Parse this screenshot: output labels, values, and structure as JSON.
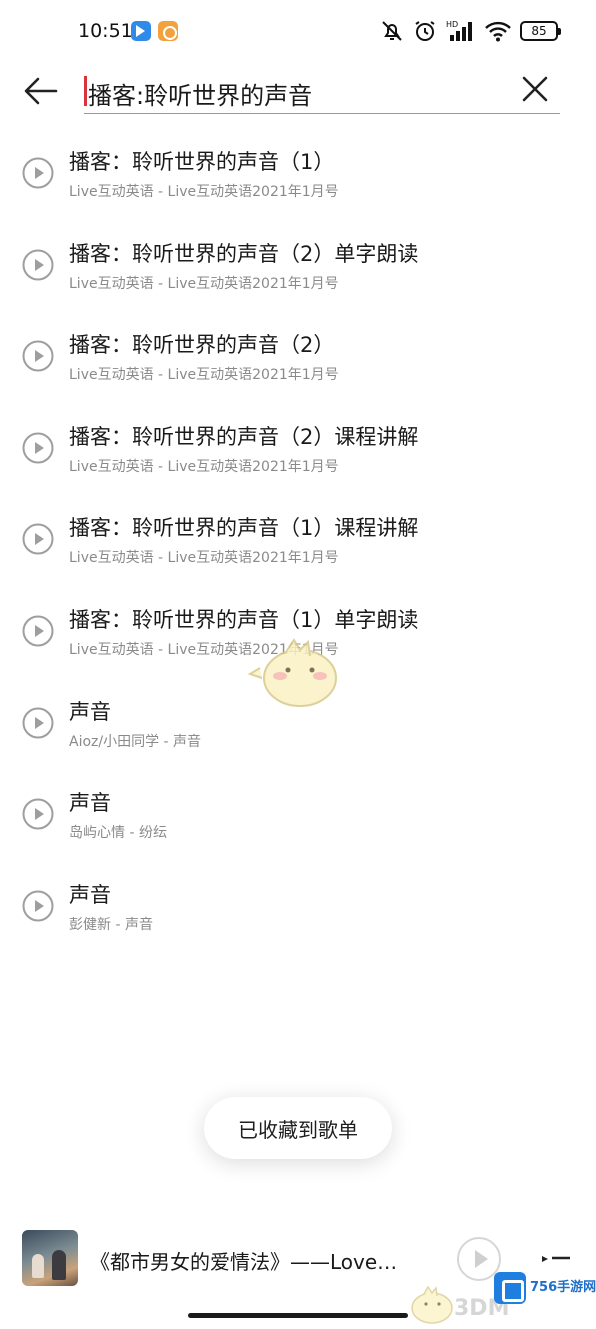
{
  "status_bar": {
    "time": "10:51",
    "battery": "85",
    "network_label": "HD"
  },
  "search": {
    "query": "播客:聆听世界的声音"
  },
  "results": [
    {
      "title": "播客：聆听世界的声音（1）",
      "subtitle": "Live互动英语 - Live互动英语2021年1月号"
    },
    {
      "title": "播客：聆听世界的声音（2）单字朗读",
      "subtitle": "Live互动英语 - Live互动英语2021年1月号"
    },
    {
      "title": "播客：聆听世界的声音（2）",
      "subtitle": "Live互动英语 - Live互动英语2021年1月号"
    },
    {
      "title": "播客：聆听世界的声音（2）课程讲解",
      "subtitle": "Live互动英语 - Live互动英语2021年1月号"
    },
    {
      "title": "播客：聆听世界的声音（1）课程讲解",
      "subtitle": "Live互动英语 - Live互动英语2021年1月号"
    },
    {
      "title": "播客：聆听世界的声音（1）单字朗读",
      "subtitle": "Live互动英语 - Live互动英语2021年1月号"
    },
    {
      "title": "声音",
      "subtitle": "Aioz/小田同学 - 声音"
    },
    {
      "title": "声音",
      "subtitle": "岛屿心情 - 纷纭"
    },
    {
      "title": "声音",
      "subtitle": "彭健新 - 声音"
    }
  ],
  "toast": {
    "text": "已收藏到歌单"
  },
  "mini_player": {
    "title": "《都市男女的爱情法》——Love…"
  },
  "watermark": {
    "site": "756手游网",
    "brand": "3DM"
  },
  "colors": {
    "cursor": "#d9343a",
    "subtitle": "#8a8a8a",
    "icon_gray": "#9e9e9e"
  },
  "icons": {
    "back": "arrow-left-icon",
    "clear": "close-icon",
    "play": "play-circle-icon",
    "playlist": "playlist-icon"
  }
}
